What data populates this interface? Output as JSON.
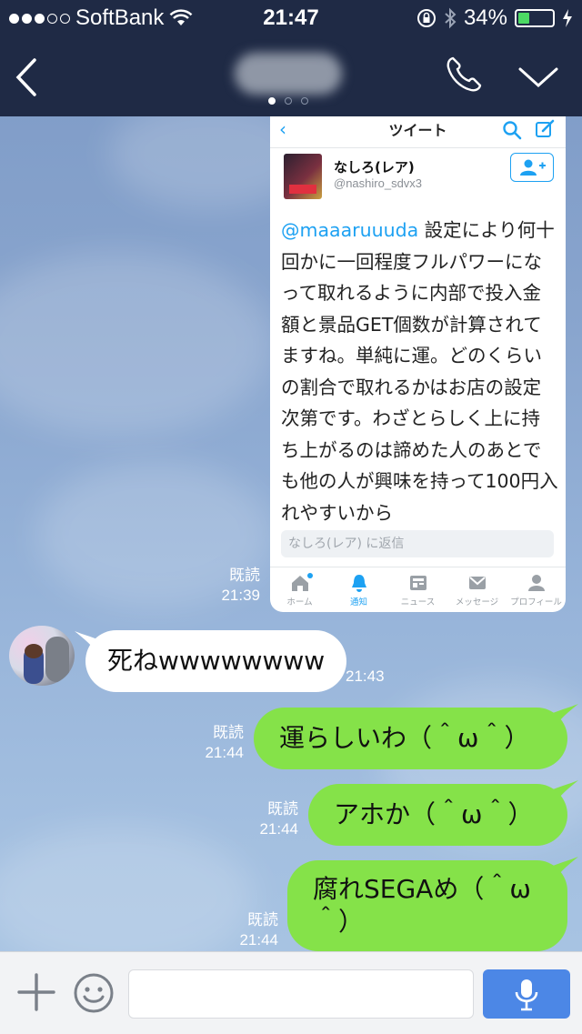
{
  "status_bar": {
    "carrier": "SoftBank",
    "time": "21:47",
    "battery_percent_text": "34%",
    "battery_level": 0.34,
    "signal_bars_filled": 3,
    "signal_bars_total": 5
  },
  "nav": {
    "title_blurred": "",
    "page_dots": 3,
    "active_page": 0,
    "icons": [
      "back-chevron-icon",
      "phone-icon",
      "chevron-down-icon"
    ]
  },
  "tweet": {
    "header_title": "ツイート",
    "author_name": "なしろ(レア)",
    "author_handle": "@nashiro_sdvx3",
    "mention": "@maaaruuuda",
    "body": " 設定により何十回かに一回程度フルパワーになって取れるように内部で投入金額と景品GET個数が計算されてますね。単純に運。どのくらいの割合で取れるかはお店の設定次第です。わざとらしく上に持ち上がるのは諦めた人のあとでも他の人が興味を持って100円入れやすいから",
    "reply_placeholder": "なしろ(レア) に返信",
    "tabs": [
      {
        "label": "ホーム",
        "icon": "home-icon"
      },
      {
        "label": "通知",
        "icon": "bell-icon"
      },
      {
        "label": "ニュース",
        "icon": "news-icon"
      },
      {
        "label": "メッセージ",
        "icon": "message-icon"
      },
      {
        "label": "プロフィール",
        "icon": "profile-icon"
      }
    ],
    "active_tab": 1,
    "accent_color": "#1da1f2"
  },
  "messages": [
    {
      "direction": "sent",
      "type": "image",
      "read_label": "既読",
      "time": "21:39"
    },
    {
      "direction": "received",
      "type": "text",
      "text": "死ねwwwwwwww",
      "time": "21:43"
    },
    {
      "direction": "sent",
      "type": "text",
      "text": "運らしいわ（＾ω＾）",
      "read_label": "既読",
      "time": "21:44"
    },
    {
      "direction": "sent",
      "type": "text",
      "text": "アホか（＾ω＾）",
      "read_label": "既読",
      "time": "21:44"
    },
    {
      "direction": "sent",
      "type": "text",
      "text_line1": "腐れSEGAめ（＾ω",
      "text_line2": "＾）",
      "read_label": "既読",
      "time": "21:44"
    }
  ],
  "input_bar": {
    "text_value": "",
    "icons": [
      "plus-icon",
      "emoji-icon",
      "microphone-icon"
    ]
  },
  "colors": {
    "nav_background": "#1f2a45",
    "sent_bubble": "#85e249",
    "received_bubble": "#ffffff",
    "mic_button": "#4c87e6"
  }
}
